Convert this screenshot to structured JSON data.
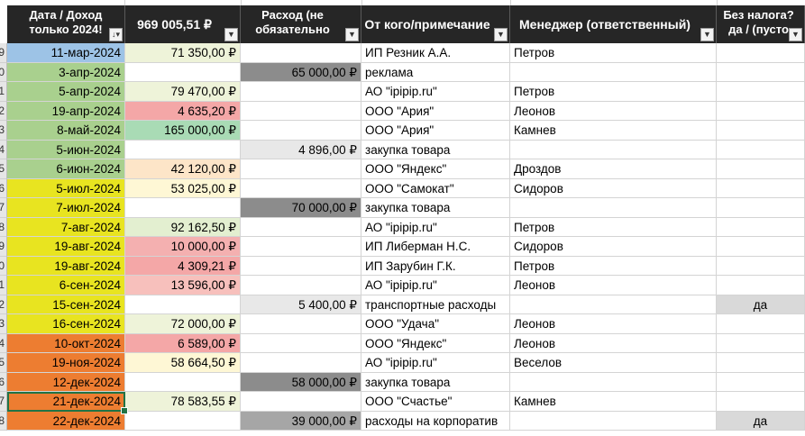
{
  "header": {
    "date_col": "Дата / Доход только 2024!",
    "income_col": "969 005,51 ₽",
    "expense_col": "Расход (не обязательно",
    "note_col": "От кого/примечание",
    "manager_col": "Менеджер (ответственный)",
    "tax_col": "Без налога? да / (пусто"
  },
  "colors": {
    "header_bg": "#262626",
    "blue": "#9dc3e6",
    "green": "#a9d08e",
    "yellow": "#e8e420",
    "orange": "#ed7d31",
    "income_light": "#eef3d9",
    "income_red": "#f4a7a7",
    "income_green": "#a9dbb5",
    "income_peach": "#fde5c8",
    "income_cream": "#fef7d5",
    "expense_dark": "#8c8c8c",
    "expense_light": "#e8e8e8",
    "expense_mid": "#a6a6a6",
    "tax_gray": "#d9d9d9"
  },
  "rows": [
    {
      "rownum": "9",
      "date": "11-мар-2024",
      "income": "71 350,00 ₽",
      "expense": "",
      "note": "ИП Резник А.А.",
      "manager": "Петров",
      "tax": "",
      "date_color": "#9dc3e6",
      "income_color": "#eef3d9",
      "expense_color": ""
    },
    {
      "rownum": "0",
      "date": "3-апр-2024",
      "income": "",
      "expense": "65 000,00 ₽",
      "note": "реклама",
      "manager": "",
      "tax": "",
      "date_color": "#a9d08e",
      "income_color": "",
      "expense_color": "#8c8c8c"
    },
    {
      "rownum": "1",
      "date": "5-апр-2024",
      "income": "79 470,00 ₽",
      "expense": "",
      "note": "АО \"ipipip.ru\"",
      "manager": "Петров",
      "tax": "",
      "date_color": "#a9d08e",
      "income_color": "#eef3d9",
      "expense_color": ""
    },
    {
      "rownum": "2",
      "date": "19-апр-2024",
      "income": "4 635,20 ₽",
      "expense": "",
      "note": "ООО \"Ария\"",
      "manager": "Леонов",
      "tax": "",
      "date_color": "#a9d08e",
      "income_color": "#f4a7a7",
      "expense_color": ""
    },
    {
      "rownum": "3",
      "date": "8-май-2024",
      "income": "165 000,00 ₽",
      "expense": "",
      "note": "ООО \"Ария\"",
      "manager": "Камнев",
      "tax": "",
      "date_color": "#a9d08e",
      "income_color": "#a9dbb5",
      "expense_color": ""
    },
    {
      "rownum": "4",
      "date": "5-июн-2024",
      "income": "",
      "expense": "4 896,00 ₽",
      "note": "закупка товара",
      "manager": "",
      "tax": "",
      "date_color": "#a9d08e",
      "income_color": "",
      "expense_color": "#e8e8e8"
    },
    {
      "rownum": "5",
      "date": "6-июн-2024",
      "income": "42 120,00 ₽",
      "expense": "",
      "note": "ООО \"Яндекс\"",
      "manager": "Дроздов",
      "tax": "",
      "date_color": "#a9d08e",
      "income_color": "#fde5c8",
      "expense_color": ""
    },
    {
      "rownum": "6",
      "date": "5-июл-2024",
      "income": "53 025,00 ₽",
      "expense": "",
      "note": "ООО \"Самокат\"",
      "manager": "Сидоров",
      "tax": "",
      "date_color": "#e8e420",
      "income_color": "#fef7d5",
      "expense_color": ""
    },
    {
      "rownum": "7",
      "date": "7-июл-2024",
      "income": "",
      "expense": "70 000,00 ₽",
      "note": "закупка товара",
      "manager": "",
      "tax": "",
      "date_color": "#e8e420",
      "income_color": "",
      "expense_color": "#8c8c8c"
    },
    {
      "rownum": "8",
      "date": "7-авг-2024",
      "income": "92 162,50 ₽",
      "expense": "",
      "note": "АО \"ipipip.ru\"",
      "manager": "Петров",
      "tax": "",
      "date_color": "#e8e420",
      "income_color": "#e3efd0",
      "expense_color": ""
    },
    {
      "rownum": "9",
      "date": "19-авг-2024",
      "income": "10 000,00 ₽",
      "expense": "",
      "note": "ИП Либерман Н.С.",
      "manager": "Сидоров",
      "tax": "",
      "date_color": "#e8e420",
      "income_color": "#f4b0b0",
      "expense_color": ""
    },
    {
      "rownum": "0",
      "date": "19-авг-2024",
      "income": "4 309,21 ₽",
      "expense": "",
      "note": "ИП Зарубин Г.К.",
      "manager": "Петров",
      "tax": "",
      "date_color": "#e8e420",
      "income_color": "#f4a7a7",
      "expense_color": ""
    },
    {
      "rownum": "1",
      "date": "6-сен-2024",
      "income": "13 596,00 ₽",
      "expense": "",
      "note": "АО \"ipipip.ru\"",
      "manager": "Леонов",
      "tax": "",
      "date_color": "#e8e420",
      "income_color": "#f7c0bc",
      "expense_color": ""
    },
    {
      "rownum": "2",
      "date": "15-сен-2024",
      "income": "",
      "expense": "5 400,00 ₽",
      "note": "транспортные расходы",
      "manager": "",
      "tax": "да",
      "date_color": "#e8e420",
      "income_color": "",
      "expense_color": "#e8e8e8"
    },
    {
      "rownum": "3",
      "date": "16-сен-2024",
      "income": "72 000,00 ₽",
      "expense": "",
      "note": "ООО \"Удача\"",
      "manager": "Леонов",
      "tax": "",
      "date_color": "#e8e420",
      "income_color": "#eef3d9",
      "expense_color": ""
    },
    {
      "rownum": "4",
      "date": "10-окт-2024",
      "income": "6 589,00 ₽",
      "expense": "",
      "note": "ООО \"Яндекс\"",
      "manager": "Леонов",
      "tax": "",
      "date_color": "#ed7d31",
      "income_color": "#f4a7a7",
      "expense_color": ""
    },
    {
      "rownum": "5",
      "date": "19-ноя-2024",
      "income": "58 664,50 ₽",
      "expense": "",
      "note": "АО \"ipipip.ru\"",
      "manager": "Веселов",
      "tax": "",
      "date_color": "#ed7d31",
      "income_color": "#fef7d5",
      "expense_color": ""
    },
    {
      "rownum": "6",
      "date": "12-дек-2024",
      "income": "",
      "expense": "58 000,00 ₽",
      "note": "закупка товара",
      "manager": "",
      "tax": "",
      "date_color": "#ed7d31",
      "income_color": "",
      "expense_color": "#8c8c8c"
    },
    {
      "rownum": "7",
      "date": "21-дек-2024",
      "income": "78 583,55 ₽",
      "expense": "",
      "note": "ООО \"Счастье\"",
      "manager": "Камнев",
      "tax": "",
      "date_color": "#ed7d31",
      "income_color": "#eef3d9",
      "expense_color": ""
    },
    {
      "rownum": "8",
      "date": "22-дек-2024",
      "income": "",
      "expense": "39 000,00 ₽",
      "note": "расходы на корпоратив",
      "manager": "",
      "tax": "да",
      "date_color": "#ed7d31",
      "income_color": "",
      "expense_color": "#a6a6a6"
    }
  ]
}
